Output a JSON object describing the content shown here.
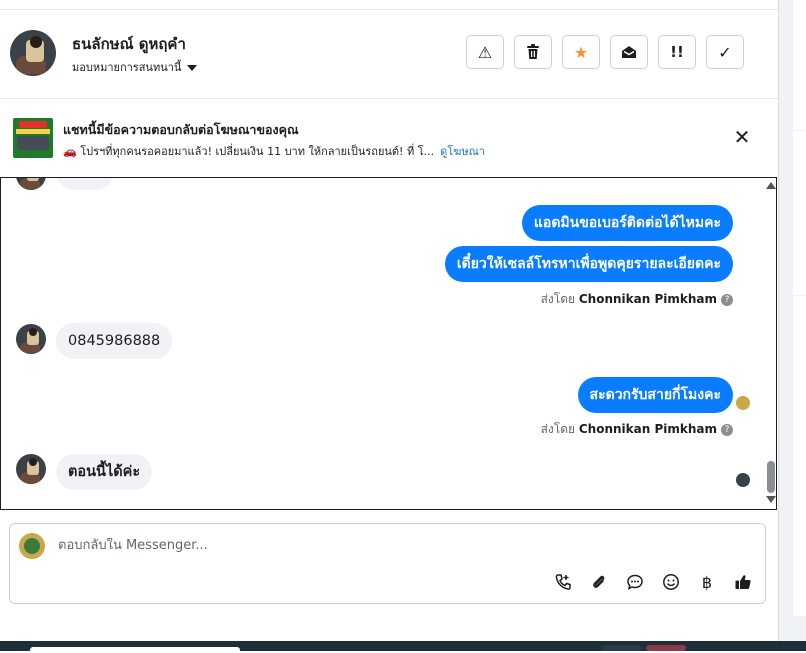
{
  "header": {
    "contact_name": "ธนลักษณ์ ดูหฤคำ",
    "assign_label": "มอบหมายการสนทนานี้",
    "tools": [
      {
        "name": "report-spam-button",
        "icon": "warning-icon",
        "glyph": "⚠"
      },
      {
        "name": "delete-button",
        "icon": "trash-icon",
        "glyph": "🗑"
      },
      {
        "name": "star-button",
        "icon": "star-icon",
        "glyph": "★"
      },
      {
        "name": "mark-unread-button",
        "icon": "envelope-open-icon",
        "glyph": "✉"
      },
      {
        "name": "follow-up-button",
        "icon": "double-exclamation-icon",
        "glyph": "!!"
      },
      {
        "name": "mark-done-button",
        "icon": "check-icon",
        "glyph": "✓"
      }
    ]
  },
  "ad": {
    "title": "แชทนี้มีข้อความตอบกลับต่อโฆษณาของคุณ",
    "subtitle": "🚗 โปรฯที่ทุกคนรอคอยมาแล้ว! เปลี่ยนเงิน 11 บาท ให้กลายเป็นรถยนต์! ที่ โ...",
    "link": "ดูโฆษณา",
    "close_glyph": "✕"
  },
  "messages": {
    "out1": "แอดมินขอเบอร์ติดต่อได้ไหมคะ",
    "out2": "เดี๋ยวให้เซลล์โทรหาเพื่อพูดคุยรายละเอียดคะ",
    "sent_by_label": "ส่งโดย",
    "sent_by_name": "Chonnikan Pimkham",
    "in1": "0845986888",
    "out3": "สะดวกรับสายกี่โมงคะ",
    "sent_by_label_2": "ส่งโดย",
    "sent_by_name_2": "Chonnikan Pimkham",
    "in2": "ตอนนี้ได้ค่ะ",
    "help_glyph": "?"
  },
  "reply": {
    "placeholder": "ตอบกลับใน Messenger...",
    "icons": [
      {
        "name": "call-add-icon",
        "glyph": "📞"
      },
      {
        "name": "attachment-icon",
        "glyph": "📎"
      },
      {
        "name": "saved-reply-icon",
        "glyph": "💬"
      },
      {
        "name": "emoji-icon",
        "glyph": "☺"
      },
      {
        "name": "baht-icon",
        "glyph": "฿"
      },
      {
        "name": "like-icon",
        "glyph": "👍"
      }
    ]
  },
  "colors": {
    "accent": "#0a7cff",
    "star": "#f7923a",
    "link": "#1a6ed8"
  }
}
